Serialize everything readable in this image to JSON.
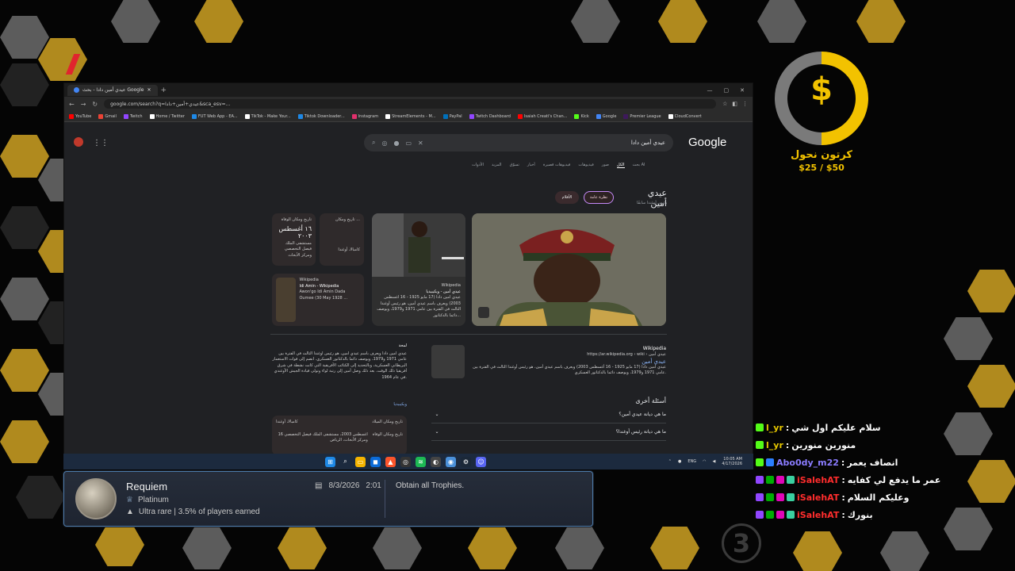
{
  "browser": {
    "tab_title": "عيدي أمين دادا - بحث Google",
    "url": "google.com/search?q=عيدي+أمين+دادا&sca_esv=...",
    "bookmarks": [
      {
        "label": "YouTube",
        "color": "#ff0000"
      },
      {
        "label": "Gmail",
        "color": "#ea4335"
      },
      {
        "label": "Twitch",
        "color": "#9146ff"
      },
      {
        "label": "Home / Twitter",
        "color": "#ffffff"
      },
      {
        "label": "FUT Web App - EA...",
        "color": "#1e88e5"
      },
      {
        "label": "TikTok - Make Your...",
        "color": "#ffffff"
      },
      {
        "label": "Tiktok Downloader...",
        "color": "#1e88e5"
      },
      {
        "label": "Instagram",
        "color": "#e1306c"
      },
      {
        "label": "StreamElements - M...",
        "color": "#ffffff"
      },
      {
        "label": "PayPal",
        "color": "#0070ba"
      },
      {
        "label": "Twitch Dashboard",
        "color": "#9146ff"
      },
      {
        "label": "Isaiah Creati's Chan...",
        "color": "#ff0000"
      },
      {
        "label": "Kick",
        "color": "#53fc18"
      },
      {
        "label": "Google",
        "color": "#4285f4"
      },
      {
        "label": "Premier League",
        "color": "#3d195b"
      },
      {
        "label": "CloudConvert",
        "color": "#ffffff"
      }
    ]
  },
  "google": {
    "logo": "Google",
    "query": "عيدي أمين دادا",
    "tabs": [
      "بحث AI",
      "الكل",
      "صور",
      "فيديوهات",
      "فيديوهات قصيرة",
      "أخبار",
      "تسوّق",
      "المزيد",
      "الأدوات"
    ],
    "kp_title": "عيدي أمين",
    "kp_subtitle": "رئيس أوغندا سابقًا",
    "chips": [
      "نظرة عامة",
      "الأفلام"
    ],
    "death_card": {
      "label": "تاريخ ومكان الوفاة",
      "date": "١٦ أغسطس ٢٠٠٣",
      "place": "مستشفى الملك فيصل التخصصي ومركز الأبحاث"
    },
    "birth_card": {
      "label": "تاريخ ومكان ...",
      "place": "كامبالا، أوغندا"
    },
    "wiki_card": {
      "source": "Wikipedia",
      "title": "Idi Amin - Wikipedia",
      "snippet": "Awon'go Idi Amin Dada Oumee (30 May 1928 ..."
    },
    "wiki_ar_card": {
      "source": "Wikipedia",
      "title": "عيدي أمين - ويكيبيديا",
      "snippet": "عيدي أمين دادا (17 مايو 1925 - 16 أغسطس 2003) ويعرف باسم عيدي أمين، هو رئيس أوغندا الثالث في الفترة بين عامي 1971 و1979، ويوصف دائما بالدكتاتور..."
    },
    "result": {
      "source": "Wikipedia",
      "url": "https://ar.wikipedia.org › wiki › عيدي أمين",
      "title": "عيدي أمين",
      "snippet": "عيدي أمين دادا (17 مايو 1925 - 16 أغسطس 2003) ويعرف باسم عيدي أمين، هو رئيس أوغندا الثالث في الفترة بين عامي 1971 و1979، ويوصف دائما بالدكتاتور العسكري."
    },
    "desc_heading": "لمحة",
    "desc_text": "عيدي أمين دادا ويعرف باسم عيدي أمين، هو رئيس أوغندا الثالث في الفترة بين عامي 1971 و1979، ويوصف دائما بالدكتاتور العسكري. انضم إلى قوات الاستعمار البريطاني العسكرية، وبالتحديد إلى الكتائب الأفريقية التي كانت نشطة في شرق أفريقيا ذلك الوقت. بعد ذلك وصل أمين إلى رتبة لواء وتولى قيادة الجيش الأوغندي في عام 1964.",
    "desc_link": "ويكيبيديا",
    "facts": [
      {
        "label": "تاريخ ومكان الميلاد",
        "value": "كامبالا، أوغندا"
      },
      {
        "label": "تاريخ ومكان الوفاة",
        "value": "16 أغسطس 2003، مستشفى الملك فيصل التخصصي ومركز الأبحاث، الرياض"
      }
    ],
    "paa_heading": "أسئلة أخرى",
    "paa": [
      "ما هي ديانة عيدي أمين؟",
      "ما هي ديانة رئيس أوغندا؟"
    ]
  },
  "taskbar": {
    "lang": "ENG",
    "time": "10:05 AM",
    "date": "4/17/2026"
  },
  "trophy": {
    "name": "Requiem",
    "grade": "Platinum",
    "rarity": "Ultra rare | 3.5% of players earned",
    "date": "8/3/2026",
    "time": "2:01",
    "description": "Obtain all Trophies."
  },
  "goal": {
    "symbol": "$",
    "title": "كرتون نحول",
    "amount": "$25 / $50",
    "progress": 0.5,
    "color": "#f2c200"
  },
  "chat": [
    {
      "user": "l_yr",
      "user_color": "#e5c600",
      "text": "سلام عليكم اول شي",
      "badges": [
        "kick"
      ]
    },
    {
      "user": "l_yr",
      "user_color": "#e5c600",
      "text": "منورين منورين",
      "badges": [
        "kick"
      ]
    },
    {
      "user": "Abo0dy_m22",
      "user_color": "#8a7cff",
      "text": "انصاف يعمر",
      "badges": [
        "kick",
        "sub"
      ]
    },
    {
      "user": "iSalehAT",
      "user_color": "#ff2d2d",
      "text": "عمر ما يدفع لي كفايه",
      "badges": [
        "twitch",
        "mod",
        "vip",
        "verified"
      ]
    },
    {
      "user": "iSalehAT",
      "user_color": "#ff2d2d",
      "text": "وعليكم السلام",
      "badges": [
        "twitch",
        "mod",
        "vip",
        "verified"
      ]
    },
    {
      "user": "iSalehAT",
      "user_color": "#ff2d2d",
      "text": "بنورك",
      "badges": [
        "twitch",
        "mod",
        "vip",
        "verified"
      ]
    }
  ],
  "overlay_number": "3"
}
